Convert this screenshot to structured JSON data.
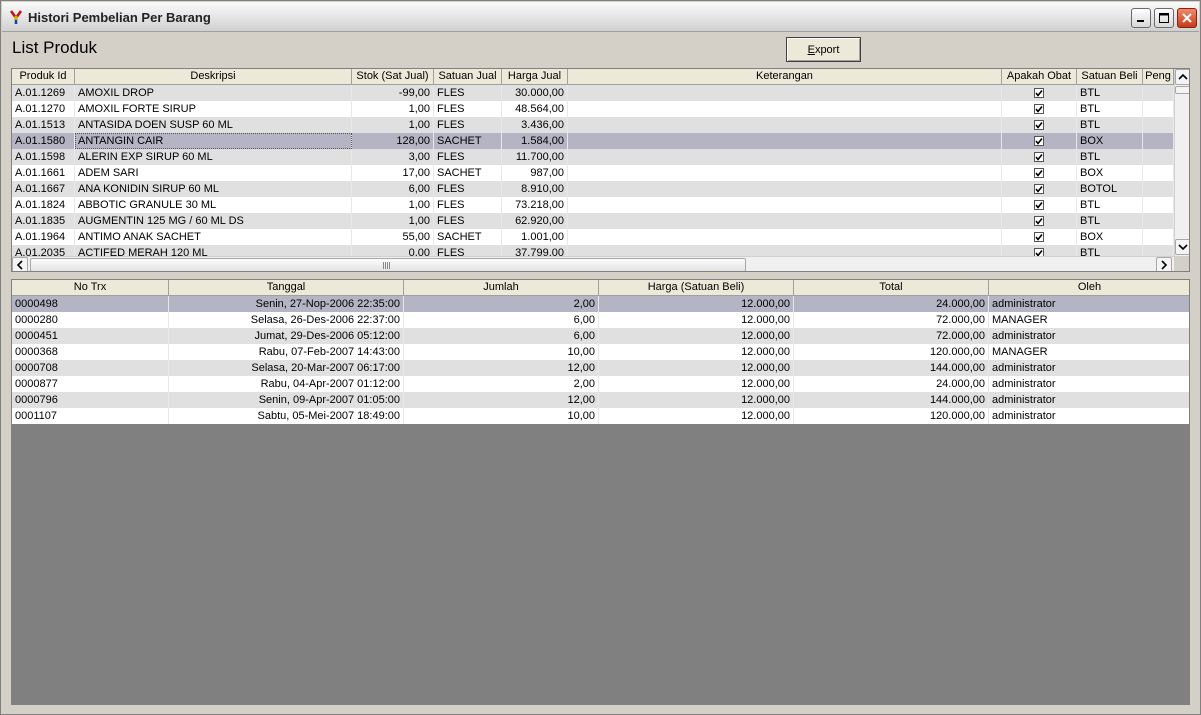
{
  "window": {
    "title": "Histori Pembelian Per Barang"
  },
  "heading": "List Produk",
  "export_button": {
    "label_accel": "E",
    "label_rest": "xport"
  },
  "products": {
    "columns": [
      "Produk Id",
      "Deskripsi",
      "Stok (Sat Jual)",
      "Satuan Jual",
      "Harga Jual",
      "Keterangan",
      "Apakah Obat",
      "Satuan Beli",
      "Peng"
    ],
    "rows": [
      {
        "id": "A.01.1269",
        "desc": "AMOXIL DROP",
        "stok": "-99,00",
        "satuan_jual": "FLES",
        "harga": "30.000,00",
        "ket": "",
        "obat": true,
        "satuan_beli": "BTL"
      },
      {
        "id": "A.01.1270",
        "desc": "AMOXIL FORTE SIRUP",
        "stok": "1,00",
        "satuan_jual": "FLES",
        "harga": "48.564,00",
        "ket": "",
        "obat": true,
        "satuan_beli": "BTL"
      },
      {
        "id": "A.01.1513",
        "desc": "ANTASIDA DOEN SUSP 60 ML",
        "stok": "1,00",
        "satuan_jual": "FLES",
        "harga": "3.436,00",
        "ket": "",
        "obat": true,
        "satuan_beli": "BTL"
      },
      {
        "id": "A.01.1580",
        "desc": "ANTANGIN CAIR",
        "stok": "128,00",
        "satuan_jual": "SACHET",
        "harga": "1.584,00",
        "ket": "",
        "obat": true,
        "satuan_beli": "BOX"
      },
      {
        "id": "A.01.1598",
        "desc": "ALERIN EXP SIRUP 60 ML",
        "stok": "3,00",
        "satuan_jual": "FLES",
        "harga": "11.700,00",
        "ket": "",
        "obat": true,
        "satuan_beli": "BTL"
      },
      {
        "id": "A.01.1661",
        "desc": "ADEM SARI",
        "stok": "17,00",
        "satuan_jual": "SACHET",
        "harga": "987,00",
        "ket": "",
        "obat": true,
        "satuan_beli": "BOX"
      },
      {
        "id": "A.01.1667",
        "desc": "ANA KONIDIN SIRUP 60 ML",
        "stok": "6,00",
        "satuan_jual": "FLES",
        "harga": "8.910,00",
        "ket": "",
        "obat": true,
        "satuan_beli": "BOTOL"
      },
      {
        "id": "A.01.1824",
        "desc": "ABBOTIC GRANULE 30 ML",
        "stok": "1,00",
        "satuan_jual": "FLES",
        "harga": "73.218,00",
        "ket": "",
        "obat": true,
        "satuan_beli": "BTL"
      },
      {
        "id": "A.01.1835",
        "desc": "AUGMENTIN 125 MG / 60 ML DS",
        "stok": "1,00",
        "satuan_jual": "FLES",
        "harga": "62.920,00",
        "ket": "",
        "obat": true,
        "satuan_beli": "BTL"
      },
      {
        "id": "A.01.1964",
        "desc": "ANTIMO ANAK SACHET",
        "stok": "55,00",
        "satuan_jual": "SACHET",
        "harga": "1.001,00",
        "ket": "",
        "obat": true,
        "satuan_beli": "BOX"
      },
      {
        "id": "A.01.2035",
        "desc": "ACTIFED MERAH 120 ML",
        "stok": "0,00",
        "satuan_jual": "FLES",
        "harga": "37.799,00",
        "ket": "",
        "obat": true,
        "satuan_beli": "BTL"
      }
    ],
    "selected_index": 3
  },
  "history": {
    "columns": [
      "No Trx",
      "Tanggal",
      "Jumlah",
      "Harga (Satuan Beli)",
      "Total",
      "Oleh"
    ],
    "rows": [
      {
        "no": "0000498",
        "tanggal": "Senin, 27-Nop-2006 22:35:00",
        "jumlah": "2,00",
        "harga": "12.000,00",
        "total": "24.000,00",
        "oleh": "administrator"
      },
      {
        "no": "0000280",
        "tanggal": "Selasa, 26-Des-2006 22:37:00",
        "jumlah": "6,00",
        "harga": "12.000,00",
        "total": "72.000,00",
        "oleh": "MANAGER"
      },
      {
        "no": "0000451",
        "tanggal": "Jumat, 29-Des-2006 05:12:00",
        "jumlah": "6,00",
        "harga": "12.000,00",
        "total": "72.000,00",
        "oleh": "administrator"
      },
      {
        "no": "0000368",
        "tanggal": "Rabu, 07-Feb-2007 14:43:00",
        "jumlah": "10,00",
        "harga": "12.000,00",
        "total": "120.000,00",
        "oleh": "MANAGER"
      },
      {
        "no": "0000708",
        "tanggal": "Selasa, 20-Mar-2007 06:17:00",
        "jumlah": "12,00",
        "harga": "12.000,00",
        "total": "144.000,00",
        "oleh": "administrator"
      },
      {
        "no": "0000877",
        "tanggal": "Rabu, 04-Apr-2007 01:12:00",
        "jumlah": "2,00",
        "harga": "12.000,00",
        "total": "24.000,00",
        "oleh": "administrator"
      },
      {
        "no": "0000796",
        "tanggal": "Senin, 09-Apr-2007 01:05:00",
        "jumlah": "12,00",
        "harga": "12.000,00",
        "total": "144.000,00",
        "oleh": "administrator"
      },
      {
        "no": "0001107",
        "tanggal": "Sabtu, 05-Mei-2007 18:49:00",
        "jumlah": "10,00",
        "harga": "12.000,00",
        "total": "120.000,00",
        "oleh": "administrator"
      }
    ],
    "selected_index": 0
  }
}
